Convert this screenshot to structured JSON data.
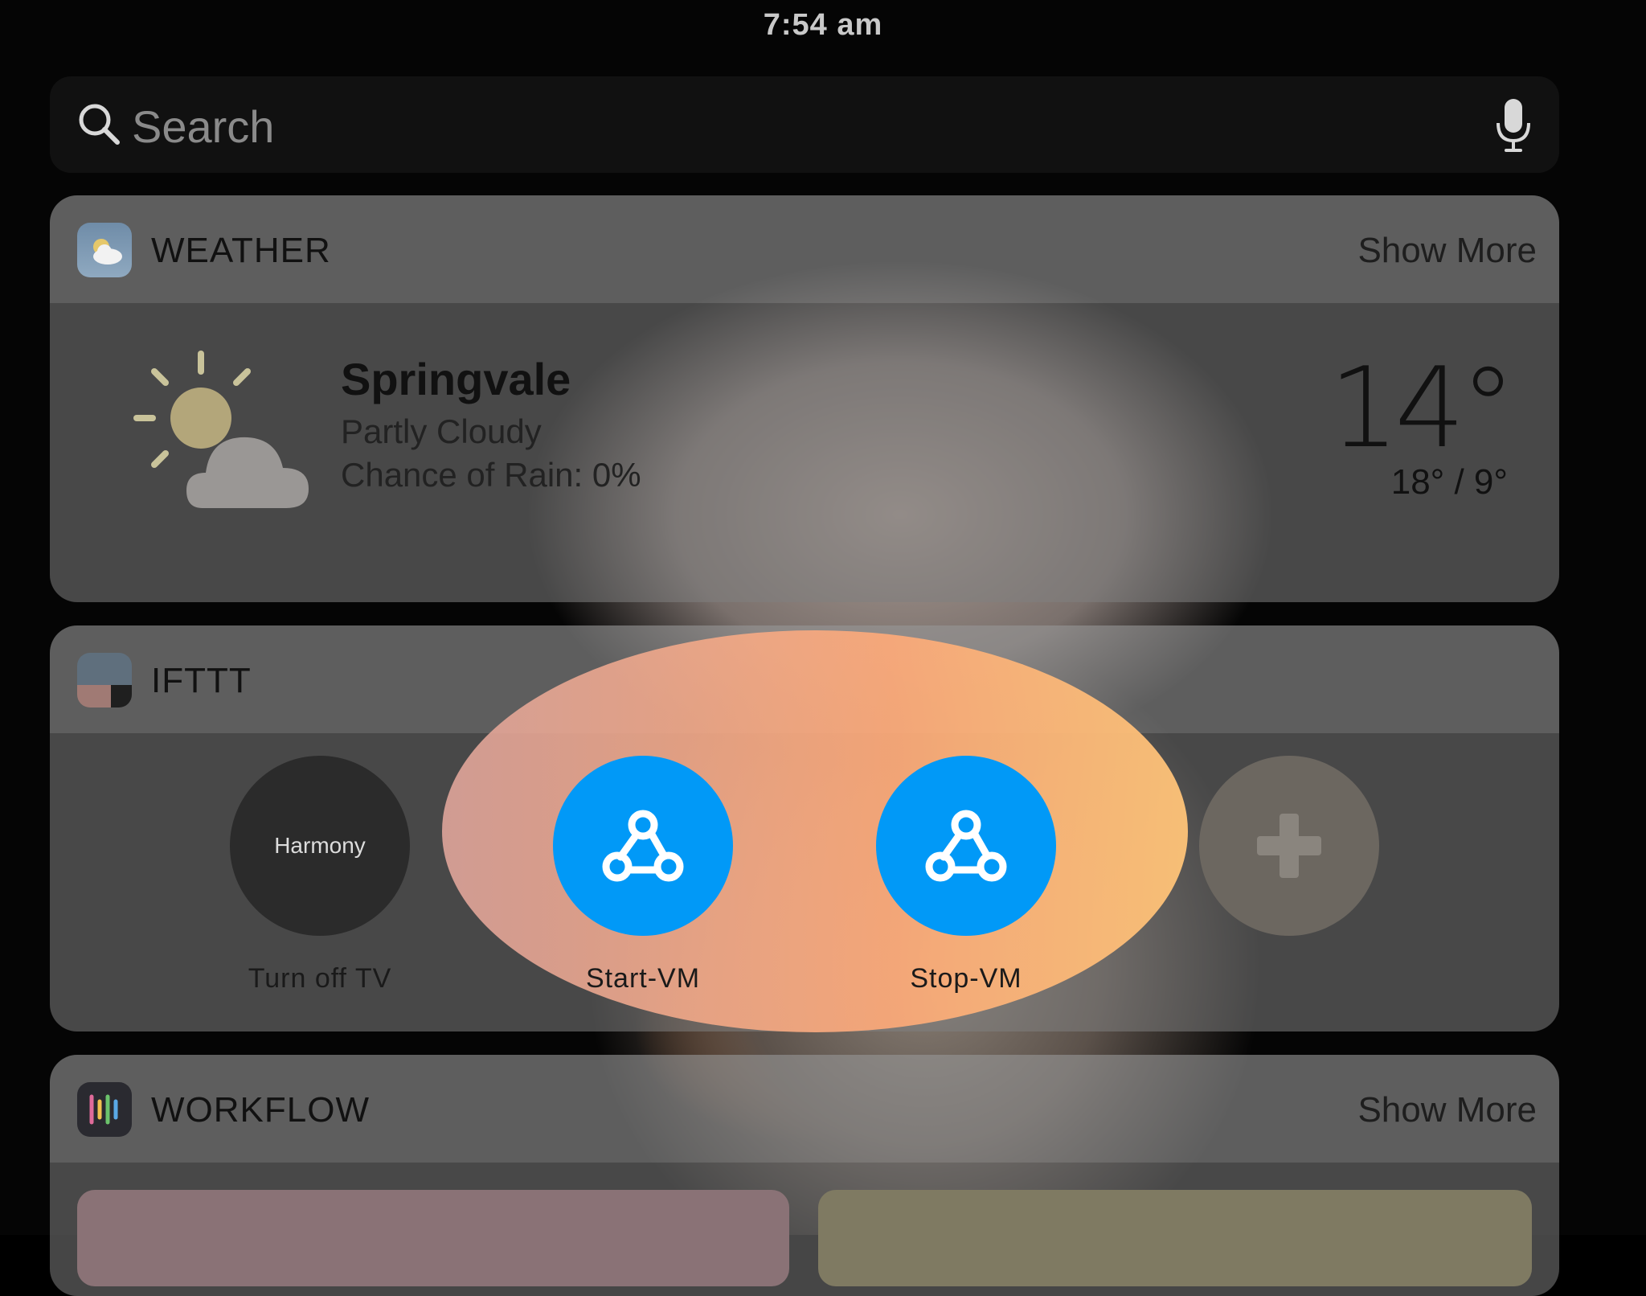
{
  "status_bar": {
    "time": "7:54 am"
  },
  "search": {
    "placeholder": "Search"
  },
  "weather_widget": {
    "app_name": "WEATHER",
    "show_more": "Show More",
    "city": "Springvale",
    "condition": "Partly Cloudy",
    "chance_of_rain": "Chance of Rain: 0%",
    "temperature": "14°",
    "high_low": "18° / 9°",
    "icon": "partly-cloudy-icon"
  },
  "ifttt_widget": {
    "app_name": "IFTTT",
    "applets": [
      {
        "label": "Turn off TV",
        "icon_text": "Harmony",
        "icon": "harmony-icon",
        "color": "#2b2b2b"
      },
      {
        "label": "Start-VM",
        "icon": "webhooks-icon",
        "color": "#0199f7"
      },
      {
        "label": "Stop-VM",
        "icon": "webhooks-icon",
        "color": "#0199f7"
      },
      {
        "label": "",
        "icon": "add-icon",
        "color": "#6c6760"
      }
    ],
    "highlight_color": "#ffb475"
  },
  "workflow_widget": {
    "app_name": "WORKFLOW",
    "show_more": "Show More"
  }
}
